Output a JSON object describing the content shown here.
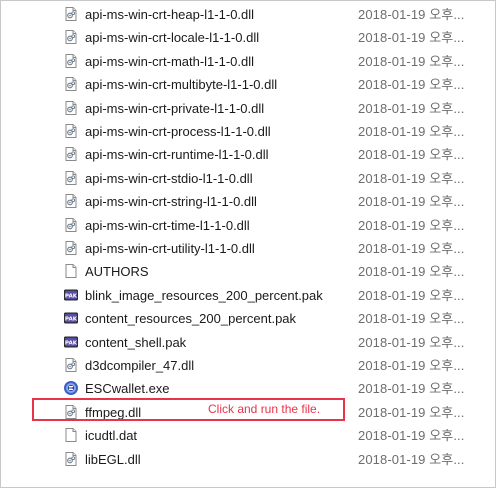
{
  "files": [
    {
      "name": "api-ms-win-crt-heap-l1-1-0.dll",
      "date": "2018-01-19 오후...",
      "icon": "dll-file-icon"
    },
    {
      "name": "api-ms-win-crt-locale-l1-1-0.dll",
      "date": "2018-01-19 오후...",
      "icon": "dll-file-icon"
    },
    {
      "name": "api-ms-win-crt-math-l1-1-0.dll",
      "date": "2018-01-19 오후...",
      "icon": "dll-file-icon"
    },
    {
      "name": "api-ms-win-crt-multibyte-l1-1-0.dll",
      "date": "2018-01-19 오후...",
      "icon": "dll-file-icon"
    },
    {
      "name": "api-ms-win-crt-private-l1-1-0.dll",
      "date": "2018-01-19 오후...",
      "icon": "dll-file-icon"
    },
    {
      "name": "api-ms-win-crt-process-l1-1-0.dll",
      "date": "2018-01-19 오후...",
      "icon": "dll-file-icon"
    },
    {
      "name": "api-ms-win-crt-runtime-l1-1-0.dll",
      "date": "2018-01-19 오후...",
      "icon": "dll-file-icon"
    },
    {
      "name": "api-ms-win-crt-stdio-l1-1-0.dll",
      "date": "2018-01-19 오후...",
      "icon": "dll-file-icon"
    },
    {
      "name": "api-ms-win-crt-string-l1-1-0.dll",
      "date": "2018-01-19 오후...",
      "icon": "dll-file-icon"
    },
    {
      "name": "api-ms-win-crt-time-l1-1-0.dll",
      "date": "2018-01-19 오후...",
      "icon": "dll-file-icon"
    },
    {
      "name": "api-ms-win-crt-utility-l1-1-0.dll",
      "date": "2018-01-19 오후...",
      "icon": "dll-file-icon"
    },
    {
      "name": "AUTHORS",
      "date": "2018-01-19 오후...",
      "icon": "blank-file-icon"
    },
    {
      "name": "blink_image_resources_200_percent.pak",
      "date": "2018-01-19 오후...",
      "icon": "pak-file-icon"
    },
    {
      "name": "content_resources_200_percent.pak",
      "date": "2018-01-19 오후...",
      "icon": "pak-file-icon"
    },
    {
      "name": "content_shell.pak",
      "date": "2018-01-19 오후...",
      "icon": "pak-file-icon"
    },
    {
      "name": "d3dcompiler_47.dll",
      "date": "2018-01-19 오후...",
      "icon": "dll-file-icon"
    },
    {
      "name": "ESCwallet.exe",
      "date": "2018-01-19 오후...",
      "icon": "app-exe-icon"
    },
    {
      "name": "ffmpeg.dll",
      "date": "2018-01-19 오후...",
      "icon": "dll-file-icon"
    },
    {
      "name": "icudtl.dat",
      "date": "2018-01-19 오후...",
      "icon": "blank-file-icon"
    },
    {
      "name": "libEGL.dll",
      "date": "2018-01-19 오후...",
      "icon": "dll-file-icon"
    }
  ],
  "annotation": {
    "text": "Click and run the file.",
    "color": "#e8344a",
    "target_file": "ESCwallet.exe"
  },
  "colors": {
    "date_text": "#6d6d6d",
    "highlight_border": "#e8344a"
  }
}
